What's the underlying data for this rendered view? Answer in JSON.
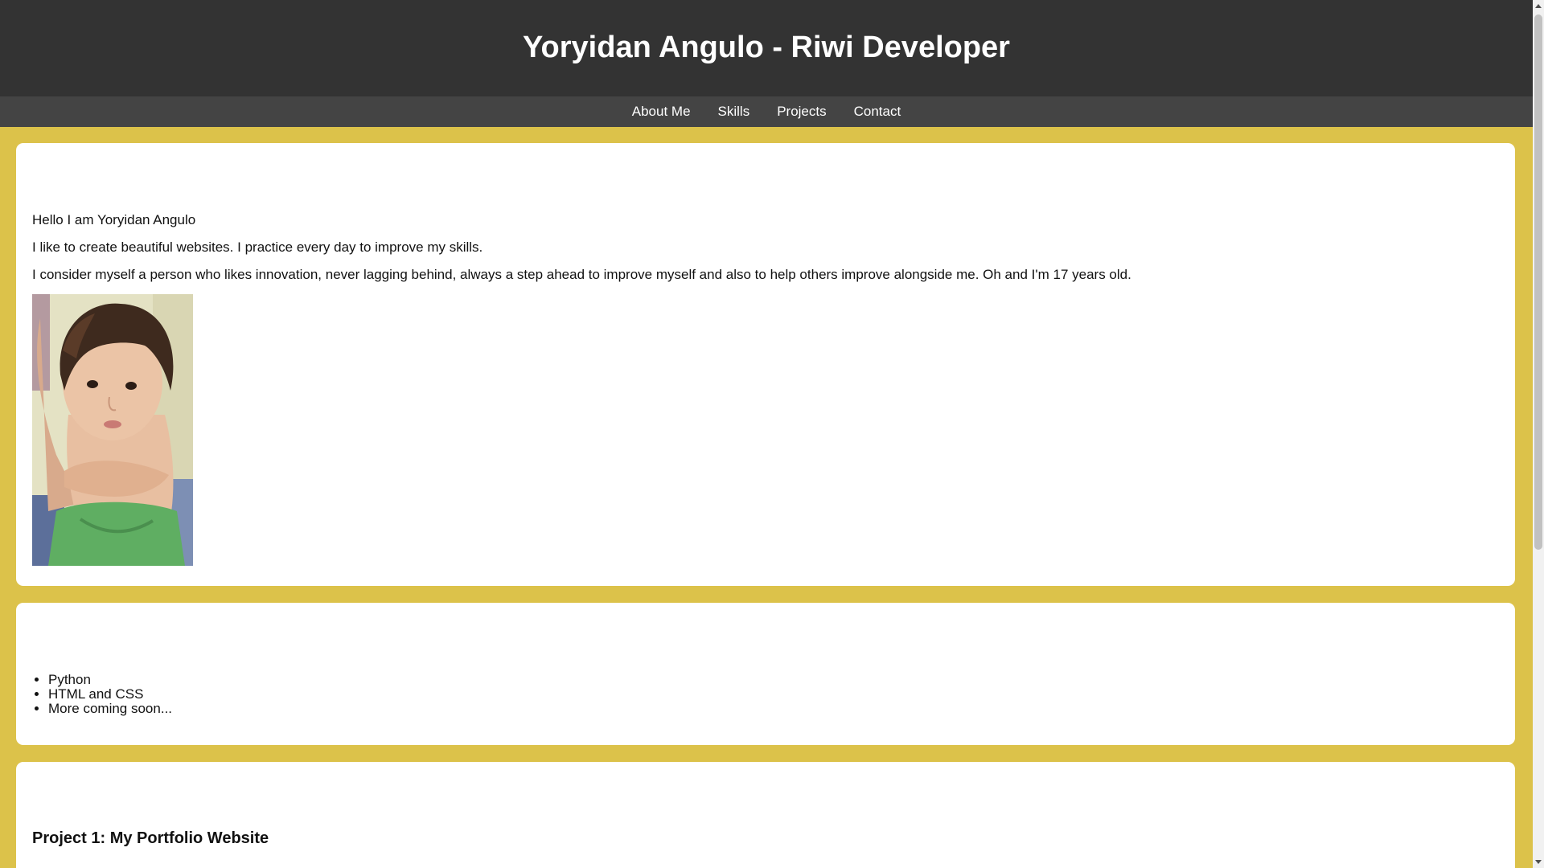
{
  "header": {
    "title": "Yoryidan Angulo - Riwi Developer"
  },
  "nav": {
    "items": [
      {
        "label": "About Me"
      },
      {
        "label": "Skills"
      },
      {
        "label": "Projects"
      },
      {
        "label": "Contact"
      }
    ]
  },
  "about": {
    "paragraphs": [
      "Hello I am Yoryidan Angulo",
      "I like to create beautiful websites. I practice every day to improve my skills.",
      "I consider myself a person who likes innovation, never lagging behind, always a step ahead to improve myself and also to help others improve alongside me. Oh and I'm 17 years old."
    ],
    "photo_icon": "profile-photo"
  },
  "skills": {
    "items": [
      "Python",
      "HTML and CSS",
      "More coming soon..."
    ]
  },
  "projects": {
    "title": "Project 1: My Portfolio Website"
  },
  "colors": {
    "header_bg": "#333333",
    "nav_bg": "#444444",
    "page_bg": "#dcc24a",
    "section_bg": "#ffffff"
  }
}
